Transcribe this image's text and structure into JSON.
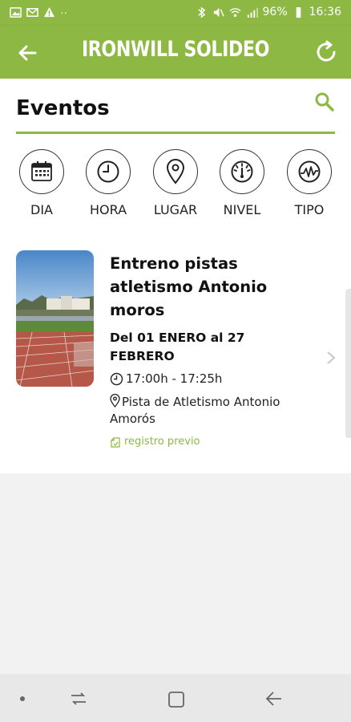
{
  "status_bar": {
    "battery": "96%",
    "time": "16:36",
    "dots": "··"
  },
  "app_bar": {
    "title": "IRONWILL SOLIDEO"
  },
  "page": {
    "heading": "Eventos"
  },
  "filters": [
    {
      "label": "DIA",
      "icon": "calendar-icon"
    },
    {
      "label": "HORA",
      "icon": "clock-icon"
    },
    {
      "label": "LUGAR",
      "icon": "location-pin-icon"
    },
    {
      "label": "NIVEL",
      "icon": "gauge-icon"
    },
    {
      "label": "TIPO",
      "icon": "activity-icon"
    }
  ],
  "event": {
    "title": "Entreno pistas atletismo Antonio moros",
    "dates": "Del 01 ENERO al 27 FEBRERO",
    "time": "17:00h - 17:25h",
    "place": "Pista de Atletismo Antonio Amorós",
    "registration": "registro previo"
  },
  "colors": {
    "brand": "#8db843",
    "text": "#111111",
    "background": "#f2f2f2"
  }
}
